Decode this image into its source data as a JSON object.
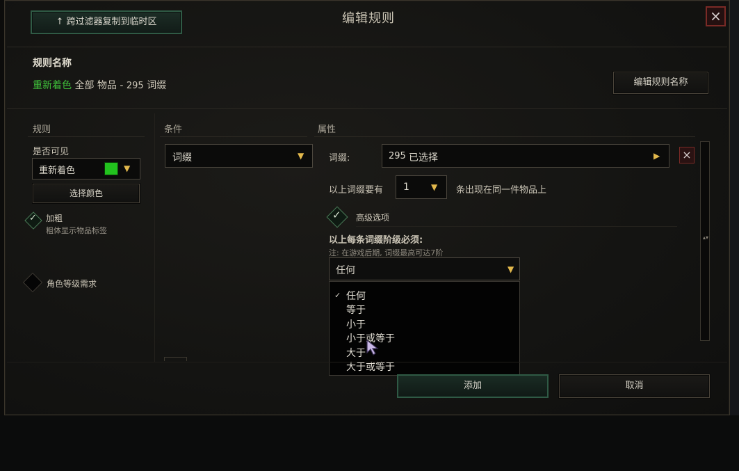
{
  "dialog": {
    "title": "编辑规则",
    "copy_button": "↑ 跨过滤器复制到临时区",
    "close_icon": "×"
  },
  "rule_name": {
    "header": "规则名称",
    "prefix": "重新着色",
    "middle": " 全部 物品 - ",
    "count": "295",
    "suffix": " 词缀",
    "edit_button": "编辑规则名称"
  },
  "rules_col": {
    "header": "规则",
    "visible_label": "是否可见",
    "visibility_value": "重新着色",
    "swatch_color": "#22c21e",
    "choose_color_button": "选择颜色",
    "bold_label": "加粗",
    "bold_desc": "粗体显示物品标签",
    "level_req_label": "角色等级需求"
  },
  "conditions_col": {
    "header": "条件",
    "selected": "词缀"
  },
  "properties_col": {
    "header": "属性",
    "affix_label": "词缀:",
    "affix_count": "295",
    "affix_selected": "已选择",
    "min_prefix": "以上词缀要有",
    "min_value": "1",
    "min_suffix": "条出现在同一件物品上",
    "advanced_label": "高级选项",
    "tier_label": "以上每条词缀阶级必须:",
    "tier_note": "注: 在游戏后期, 词缀最高可达7阶",
    "tier_selected": "任何",
    "tier_options": [
      "任何",
      "等于",
      "小于",
      "小于或等于",
      "大于",
      "大于或等于"
    ]
  },
  "footer": {
    "add_button": "添加",
    "cancel_button": "取消"
  }
}
